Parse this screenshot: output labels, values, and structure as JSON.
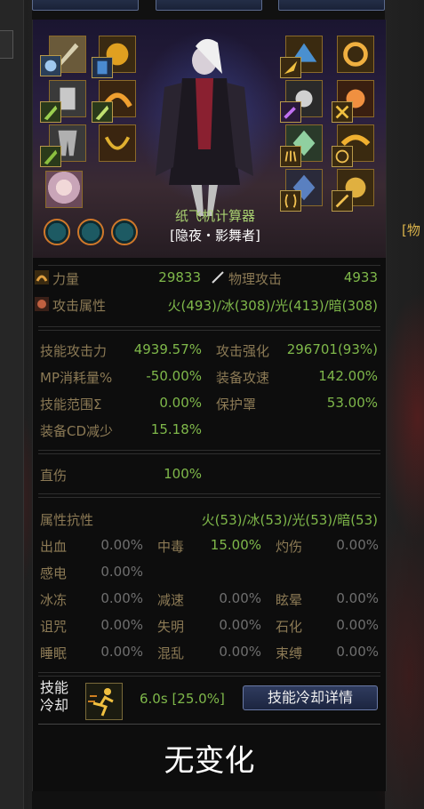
{
  "character": {
    "name": "纸飞机计算器",
    "class_label": "[隐夜・影舞者]"
  },
  "side_label": "[物",
  "base_stats": {
    "strength_label": "力量",
    "strength_value": "29833",
    "phys_attack_label": "物理攻击",
    "phys_attack_value": "4933",
    "element_label": "攻击属性",
    "element_value": "火(493)/冰(308)/光(413)/暗(308)"
  },
  "skill_stats": [
    {
      "label": "技能攻击力",
      "value": "4939.57%",
      "label2": "攻击强化",
      "value2": "296701(93%)"
    },
    {
      "label": "MP消耗量%",
      "value": "-50.00%",
      "label2": "装备攻速",
      "value2": "142.00%"
    },
    {
      "label": "技能范围Σ",
      "value": "0.00%",
      "label2": "保护罩",
      "value2": "53.00%"
    },
    {
      "label": "装备CD减少",
      "value": "15.18%"
    }
  ],
  "direct_damage": {
    "label": "直伤",
    "value": "100%"
  },
  "resistance": {
    "label": "属性抗性",
    "value": "火(53)/冰(53)/光(53)/暗(53)"
  },
  "status_resist": [
    [
      {
        "label": "出血",
        "value": "0.00%"
      },
      {
        "label": "中毒",
        "value": "15.00%",
        "highlight": true
      },
      {
        "label": "灼伤",
        "value": "0.00%"
      }
    ],
    [
      {
        "label": "感电",
        "value": "0.00%"
      }
    ],
    [
      {
        "label": "冰冻",
        "value": "0.00%"
      },
      {
        "label": "减速",
        "value": "0.00%"
      },
      {
        "label": "眩晕",
        "value": "0.00%"
      }
    ],
    [
      {
        "label": "诅咒",
        "value": "0.00%"
      },
      {
        "label": "失明",
        "value": "0.00%"
      },
      {
        "label": "石化",
        "value": "0.00%"
      }
    ],
    [
      {
        "label": "睡眠",
        "value": "0.00%"
      },
      {
        "label": "混乱",
        "value": "0.00%"
      },
      {
        "label": "束缚",
        "value": "0.00%"
      }
    ]
  ],
  "cooldown": {
    "label_line1": "技能",
    "label_line2": "冷却",
    "value": "6.0s [25.0%]",
    "details_button": "技能冷却详情"
  },
  "result_text": "无变化",
  "colors": {
    "label": "#8c7a55",
    "value_green": "#7fb84a",
    "value_gray": "#6f6f6f",
    "name_green": "#a8d070"
  }
}
